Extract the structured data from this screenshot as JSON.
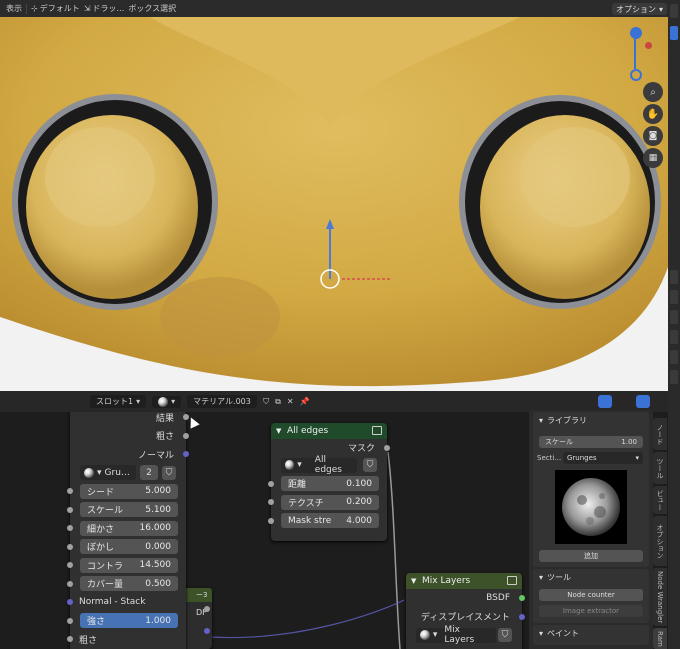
{
  "topbar": {
    "mode_label": "表示",
    "orientation_label": "デフォルト",
    "drag_label": "ドラッ…",
    "select_label": "ボックス選択",
    "options_label": "オプション"
  },
  "viewport": {
    "nav_icons": [
      "zoom-icon",
      "hand-icon",
      "camera-icon",
      "grid-icon"
    ]
  },
  "node_header": {
    "slot_label": "スロット1",
    "material_name": "マテリアル.003"
  },
  "node_left": {
    "outputs": [
      "結果",
      "粗さ",
      "ノーマル"
    ],
    "dropdown_label": "Gru…",
    "dropdown_count": "2",
    "fields": [
      {
        "label": "シード",
        "value": "5.000"
      },
      {
        "label": "スケール",
        "value": "5.100"
      },
      {
        "label": "細かさ",
        "value": "16.000"
      },
      {
        "label": "ぼかし",
        "value": "0.000"
      },
      {
        "label": "コントラ",
        "value": "14.500"
      },
      {
        "label": "カバー量",
        "value": "0.500"
      }
    ],
    "normal_stack_label": "Normal - Stack",
    "strength_label": "強さ",
    "strength_value": "1.000",
    "roughness_label": "粗さ"
  },
  "node_all_edges": {
    "title": "All edges",
    "output_label": "マスク",
    "dropdown_label": "All edges",
    "fields": [
      {
        "label": "距離",
        "value": "0.100"
      },
      {
        "label": "テクスチ",
        "value": "0.200"
      },
      {
        "label": "Mask stre",
        "value": "4.000"
      }
    ]
  },
  "node_mix_layers": {
    "title": "Mix Layers",
    "outputs": [
      "BSDF",
      "ディスプレイスメント"
    ],
    "dropdown_label": "Mix Layers"
  },
  "node_partial": {
    "tag_label": "ー3",
    "output_fragment": "DF"
  },
  "sidebar": {
    "library_title": "ライブラリ",
    "scale_label": "スケール",
    "scale_value": "1.00",
    "section_label": "Secti…",
    "section_value": "Grunges",
    "apply_button": "追加",
    "tools_title": "ツール",
    "node_counter_button": "Node counter",
    "image_extractor_button": "Image extractor",
    "paint_title": "ペイント"
  },
  "vertical_tabs": [
    "ノード",
    "ツール",
    "ビュー",
    "オプション",
    "Node Wrangler",
    "Ram"
  ]
}
